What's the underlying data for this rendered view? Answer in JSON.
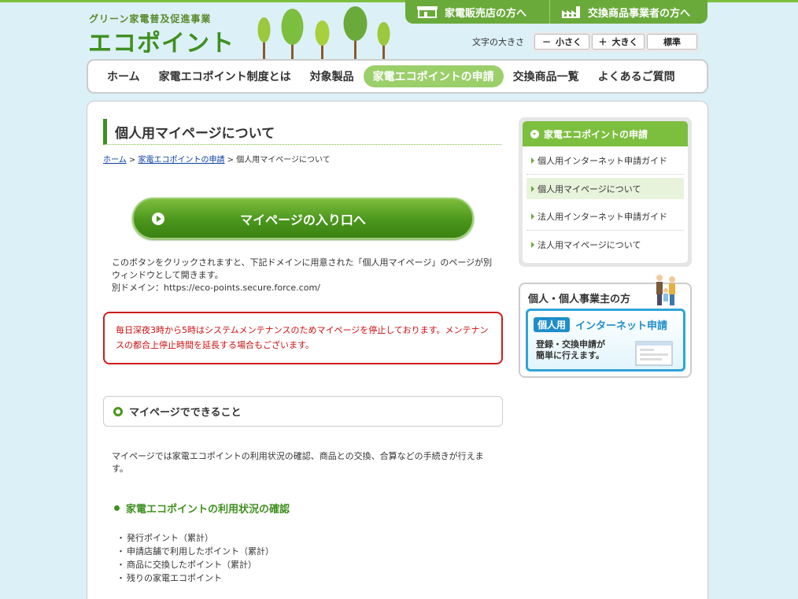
{
  "header": {
    "logo_sub": "グリーン家電普及促進事業",
    "logo_main": "エコポイント",
    "top_tabs": [
      {
        "label": "家電販売店の方へ",
        "icon": "store-icon"
      },
      {
        "label": "交換商品事業者の方へ",
        "icon": "factory-icon"
      }
    ],
    "fontsize": {
      "label": "文字の大きさ",
      "smaller": "小さく",
      "larger": "大きく",
      "standard": "標準"
    }
  },
  "nav": {
    "items": [
      "ホーム",
      "家電エコポイント制度とは",
      "対象製品",
      "家電エコポイントの申請",
      "交換商品一覧",
      "よくあるご質問"
    ],
    "active_index": 3
  },
  "main": {
    "title": "個人用マイページについて",
    "breadcrumb": {
      "home": "ホーム",
      "sep": ">",
      "parent": "家電エコポイントの申請",
      "current": "個人用マイページについて"
    },
    "entry_button": "マイページの入り口へ",
    "desc_line1": "このボタンをクリックされますと、下記ドメインに用意された「個人用マイページ」のページが別ウィンドウとして開きます。",
    "desc_line2": "別ドメイン：https://eco-points.secure.force.com/",
    "alert": "毎日深夜3時から5時はシステムメンテナンスのためマイページを停止しております。メンテナンスの都合上停止時間を延長する場合もございます。",
    "section_title": "マイページでできること",
    "section_desc": "マイページでは家電エコポイントの利用状況の確認、商品との交換、合算などの手続きが行えます。",
    "sub_heading": "家電エコポイントの利用状況の確認",
    "bullets": [
      "発行ポイント（累計）",
      "申請店舗で利用したポイント（累計）",
      "商品に交換したポイント（累計）",
      "残りの家電エコポイント"
    ]
  },
  "sidebar": {
    "menu_title": "家電エコポイントの申請",
    "items": [
      "個人用インターネット申請ガイド",
      "個人用マイページについて",
      "法人用インターネット申請ガイド",
      "法人用マイページについて"
    ],
    "active_index": 1,
    "promo": {
      "title": "個人・個人事業主の方",
      "tag": "個人用",
      "net": "インターネット申請",
      "desc_line1": "登録・交換申請が",
      "desc_line2": "簡単に行えます。"
    }
  },
  "colors": {
    "brand_green": "#3f8f1f",
    "accent_green": "#7cbf3f",
    "alert_red": "#cc1c1c",
    "promo_blue": "#2fa4d9",
    "background": "#dcf0f7"
  }
}
